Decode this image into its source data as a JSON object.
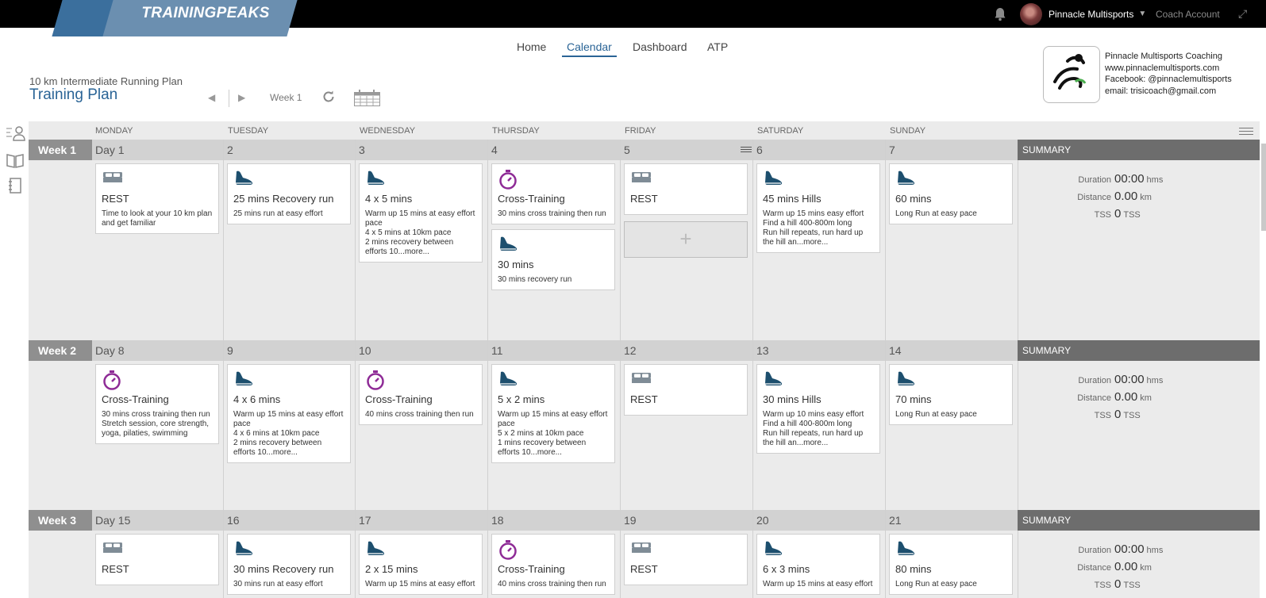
{
  "topbar": {
    "logo_text": "TRAININGPEAKS",
    "account_name": "Pinnacle Multisports",
    "coach_account": "Coach Account"
  },
  "nav": [
    "Home",
    "Calendar",
    "Dashboard",
    "ATP"
  ],
  "plan": {
    "subtitle": "10 km Intermediate Running Plan",
    "title": "Training Plan",
    "week": "Week 1"
  },
  "brand": {
    "lines": [
      "Pinnacle Multisports Coaching",
      "www.pinnaclemultisports.com",
      "Facebook: @pinnaclemultisports",
      "email: trisicoach@gmail.com"
    ]
  },
  "days": [
    "MONDAY",
    "TUESDAY",
    "WEDNESDAY",
    "THURSDAY",
    "FRIDAY",
    "SATURDAY",
    "SUNDAY"
  ],
  "summary": {
    "header": "SUMMARY",
    "duration_label": "Duration",
    "duration_value": "00:00",
    "duration_unit": "hms",
    "distance_label": "Distance",
    "distance_value": "0.00",
    "distance_unit": "km",
    "tss_label": "TSS",
    "tss_value": "0",
    "tss_unit": "TSS"
  },
  "weeks": [
    {
      "label": "Week 1",
      "days": [
        "Day 1",
        "2",
        "3",
        "4",
        "5",
        "6",
        "7"
      ],
      "workouts": [
        [
          {
            "icon": "rest",
            "title": "REST",
            "desc": "Time to look at your 10 km plan and get familiar"
          }
        ],
        [
          {
            "icon": "run",
            "title": "25 mins Recovery run",
            "desc": "25 mins run at easy effort"
          }
        ],
        [
          {
            "icon": "run",
            "title": "4 x 5 mins",
            "desc": "Warm up 15 mins at easy effort pace\n4 x 5 mins at 10km pace\n2 mins recovery between efforts 10...more..."
          }
        ],
        [
          {
            "icon": "cross",
            "title": "Cross-Training",
            "desc": "30 mins cross training then run"
          },
          {
            "icon": "run",
            "title": "30 mins",
            "desc": "30 mins recovery run"
          }
        ],
        [
          {
            "icon": "rest",
            "title": "REST",
            "desc": ""
          }
        ],
        [
          {
            "icon": "run",
            "title": "45 mins Hills",
            "desc": "Warm up 15 mins easy effort\nFind a hill 400-800m long\nRun hill repeats, run hard up the hill an...more..."
          }
        ],
        [
          {
            "icon": "run",
            "title": "60 mins",
            "desc": "Long Run at easy pace"
          }
        ]
      ]
    },
    {
      "label": "Week 2",
      "days": [
        "Day 8",
        "9",
        "10",
        "11",
        "12",
        "13",
        "14"
      ],
      "workouts": [
        [
          {
            "icon": "cross",
            "title": "Cross-Training",
            "desc": "30 mins cross training then run\nStretch session, core strength, yoga, pilaties, swimming"
          }
        ],
        [
          {
            "icon": "run",
            "title": "4 x 6 mins",
            "desc": "Warm up 15 mins at easy effort pace\n4 x 6 mins at 10km pace\n2 mins recovery between efforts 10...more..."
          }
        ],
        [
          {
            "icon": "cross",
            "title": "Cross-Training",
            "desc": "40 mins cross training then run"
          }
        ],
        [
          {
            "icon": "run",
            "title": "5 x 2 mins",
            "desc": "Warm up 15 mins at easy effort pace\n5 x 2 mins at 10km pace\n1 mins recovery between efforts 10...more..."
          }
        ],
        [
          {
            "icon": "rest",
            "title": "REST",
            "desc": ""
          }
        ],
        [
          {
            "icon": "run",
            "title": "30 mins Hills",
            "desc": "Warm up 10 mins easy effort\nFind a hill 400-800m long\nRun hill repeats, run hard up the hill an...more..."
          }
        ],
        [
          {
            "icon": "run",
            "title": "70 mins",
            "desc": "Long Run at easy pace"
          }
        ]
      ]
    },
    {
      "label": "Week 3",
      "days": [
        "Day 15",
        "16",
        "17",
        "18",
        "19",
        "20",
        "21"
      ],
      "workouts": [
        [
          {
            "icon": "rest",
            "title": "REST",
            "desc": ""
          }
        ],
        [
          {
            "icon": "run",
            "title": "30 mins Recovery run",
            "desc": "30 mins run at easy effort"
          }
        ],
        [
          {
            "icon": "run",
            "title": "2 x 15 mins",
            "desc": "Warm up 15 mins at easy effort"
          }
        ],
        [
          {
            "icon": "cross",
            "title": "Cross-Training",
            "desc": "40 mins cross training then run"
          }
        ],
        [
          {
            "icon": "rest",
            "title": "REST",
            "desc": ""
          }
        ],
        [
          {
            "icon": "run",
            "title": "6 x 3 mins",
            "desc": "Warm up 15 mins at easy effort"
          }
        ],
        [
          {
            "icon": "run",
            "title": "80 mins",
            "desc": "Long Run at easy pace"
          }
        ]
      ]
    }
  ]
}
